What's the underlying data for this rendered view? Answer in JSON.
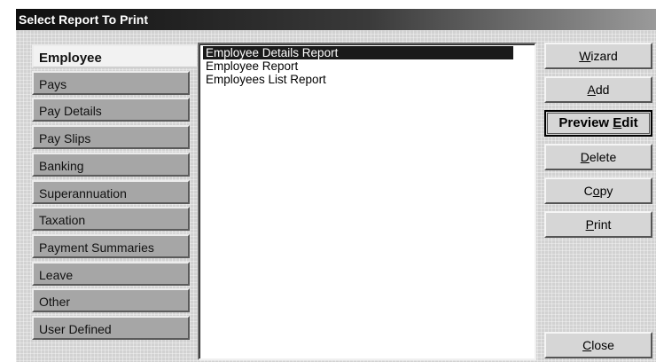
{
  "window": {
    "title": "Select Report To Print"
  },
  "tabs": [
    {
      "label": "Employee",
      "active": true
    },
    {
      "label": "Pays"
    },
    {
      "label": "Pay Details"
    },
    {
      "label": "Pay Slips"
    },
    {
      "label": "Banking"
    },
    {
      "label": "Superannuation"
    },
    {
      "label": "Taxation"
    },
    {
      "label": "Payment Summaries"
    },
    {
      "label": "Leave"
    },
    {
      "label": "Other"
    },
    {
      "label": "User Defined"
    }
  ],
  "reports": [
    {
      "label": "Employee Details Report",
      "selected": true
    },
    {
      "label": "Employee Report"
    },
    {
      "label": "Employees List Report"
    }
  ],
  "buttons": {
    "wizard": {
      "pre": "",
      "key": "W",
      "post": "izard"
    },
    "add": {
      "pre": "",
      "key": "A",
      "post": "dd"
    },
    "preview_edit": {
      "pre": "Preview ",
      "key": "E",
      "post": "dit"
    },
    "delete": {
      "pre": "",
      "key": "D",
      "post": "elete"
    },
    "copy": {
      "pre": "C",
      "key": "o",
      "post": "py"
    },
    "print": {
      "pre": "",
      "key": "P",
      "post": "rint"
    },
    "close": {
      "pre": "",
      "key": "C",
      "post": "lose"
    }
  }
}
